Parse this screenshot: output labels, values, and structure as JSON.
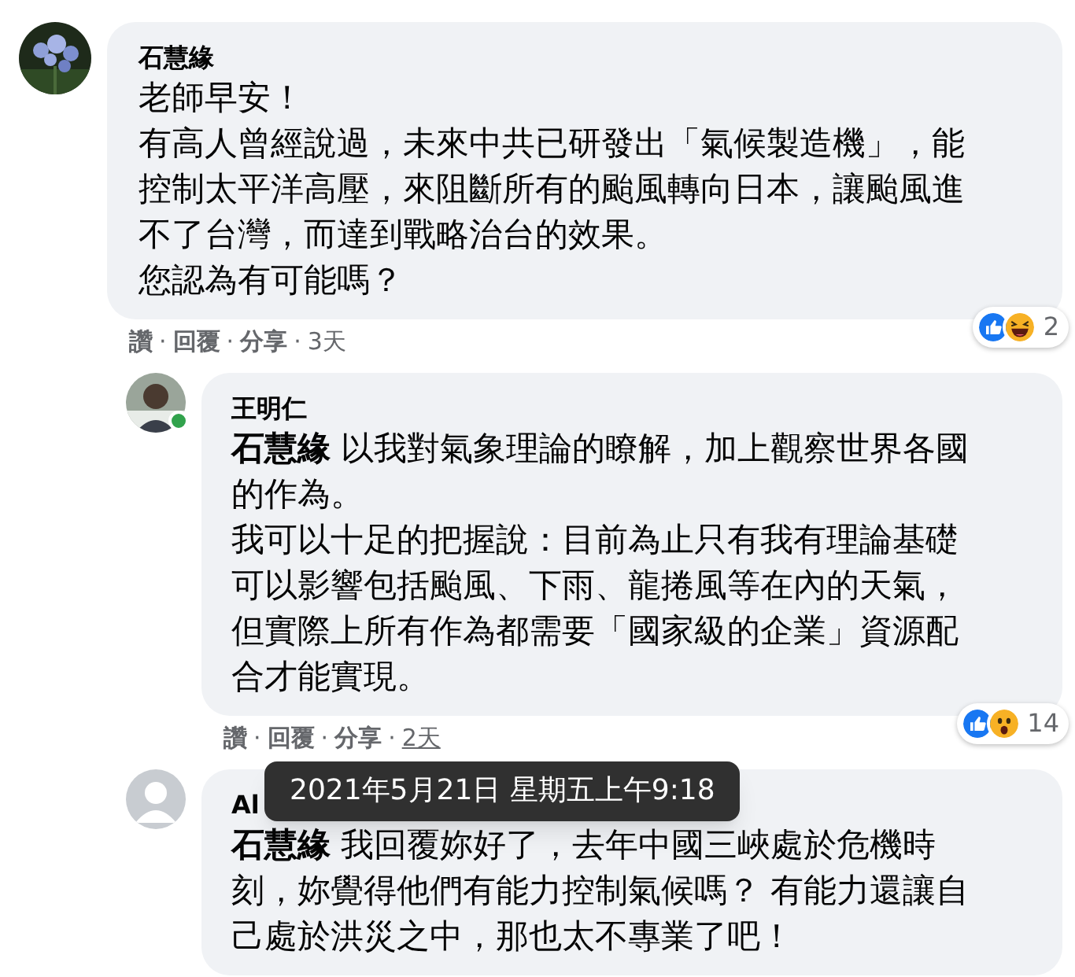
{
  "comments": [
    {
      "author": "石慧緣",
      "avatar": {
        "kind": "picture"
      },
      "online": false,
      "paragraphs": [
        "老師早安！",
        "有高人曾經說過，未來中共已研發出「氣候製造機」，能控制太平洋高壓，來阻斷所有的颱風轉向日本，讓颱風進不了台灣，而達到戰略治台的效果。",
        "您認為有可能嗎？"
      ],
      "actions": [
        "讚",
        "回覆",
        "分享"
      ],
      "separator": "·",
      "time": "3天",
      "time_hovered": false,
      "reactions": [
        {
          "kind": "like"
        },
        {
          "kind": "haha"
        }
      ],
      "reaction_count": "2",
      "children": [
        {
          "author": "王明仁",
          "avatar": {
            "kind": "person"
          },
          "online": true,
          "paragraphs": [
            "**石慧緣** 以我對氣象理論的瞭解，加上觀察世界各國的作為。",
            "我可以十足的把握說：目前為止只有我有理論基礎可以影響包括颱風、下雨、龍捲風等在內的天氣，但實際上所有作為都需要「國家級的企業」資源配合才能實現。"
          ],
          "actions": [
            "讚",
            "回覆",
            "分享"
          ],
          "separator": "·",
          "time": "2天",
          "time_hovered": true,
          "reactions": [
            {
              "kind": "like"
            },
            {
              "kind": "wow"
            }
          ],
          "reaction_count": "14"
        },
        {
          "author": "Al",
          "avatar": {
            "kind": "default"
          },
          "online": false,
          "paragraphs": [
            "**石慧緣** 我回覆妳好了，去年中國三峽處於危機時刻，妳覺得他們有能力控制氣候嗎？ 有能力還讓自己處於洪災之中，那也太不專業了吧！"
          ]
        }
      ]
    }
  ],
  "tooltip": {
    "text": "2021年5月21日 星期五上午9:18"
  }
}
